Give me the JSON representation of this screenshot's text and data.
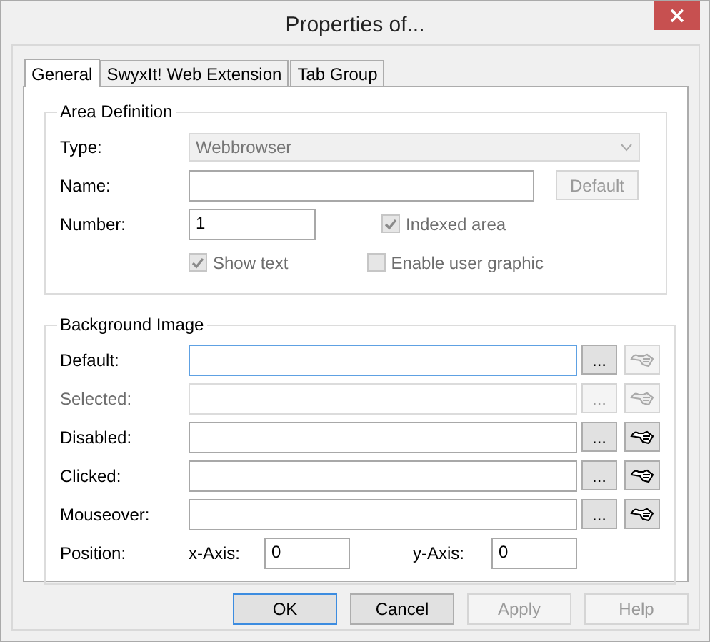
{
  "window": {
    "title": "Properties of..."
  },
  "tabs": [
    {
      "label": "General",
      "selected": true
    },
    {
      "label": "SwyxIt! Web Extension",
      "selected": false
    },
    {
      "label": "Tab Group",
      "selected": false
    }
  ],
  "area_definition": {
    "title": "Area Definition",
    "type": {
      "label": "Type:",
      "value": "Webbrowser",
      "disabled": true
    },
    "name": {
      "label": "Name:",
      "button": "Default",
      "button_disabled": true
    },
    "number": {
      "label": "Number:",
      "value": "1"
    },
    "checkboxes": [
      {
        "label": "Indexed area",
        "checked": true,
        "disabled": true
      },
      {
        "label": "Show text",
        "checked": true,
        "disabled": true
      },
      {
        "label": "Enable user graphic",
        "checked": false,
        "disabled": true
      }
    ]
  },
  "background_image": {
    "title": "Background Image",
    "rows": [
      {
        "label": "Default:",
        "browse": "...",
        "disabled": false,
        "focused": true,
        "picker_disabled": true
      },
      {
        "label": "Selected:",
        "browse": "...",
        "disabled": true,
        "focused": false,
        "picker_disabled": true
      },
      {
        "label": "Disabled:",
        "browse": "...",
        "disabled": false,
        "focused": false,
        "picker_disabled": false
      },
      {
        "label": "Clicked:",
        "browse": "...",
        "disabled": false,
        "focused": false,
        "picker_disabled": false
      },
      {
        "label": "Mouseover:",
        "browse": "...",
        "disabled": false,
        "focused": false,
        "picker_disabled": false
      }
    ],
    "position": {
      "label": "Position:",
      "x_label": "x-Axis:",
      "x_value": "0",
      "y_label": "y-Axis:",
      "y_value": "0"
    }
  },
  "buttons": [
    {
      "label": "OK",
      "disabled": false,
      "default": true
    },
    {
      "label": "Cancel",
      "disabled": false,
      "default": false
    },
    {
      "label": "Apply",
      "disabled": true,
      "default": false
    },
    {
      "label": "Help",
      "disabled": true,
      "default": false
    }
  ]
}
